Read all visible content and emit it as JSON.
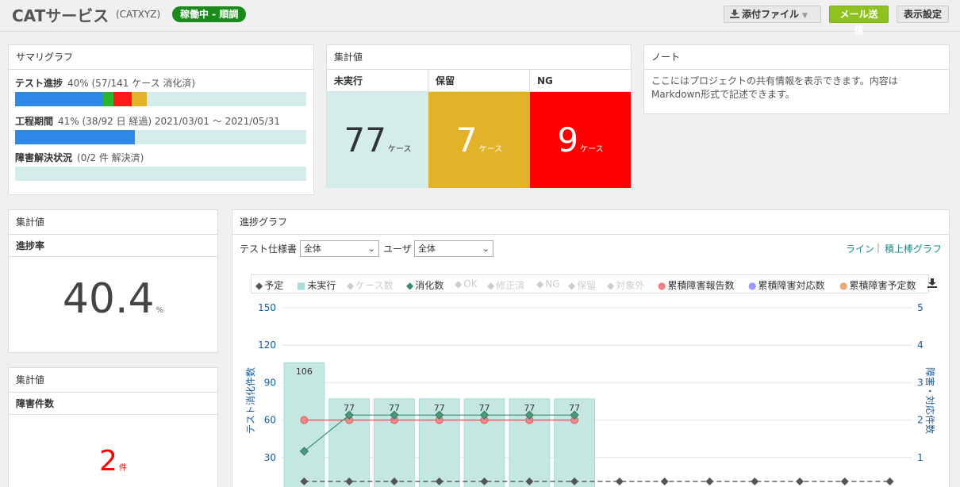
{
  "header": {
    "title": "CATサービス",
    "code": "(CATXYZ)",
    "status": "稼働中 - 順調",
    "attach_label": "添付ファイル",
    "mail_label": "メール送信",
    "display_label": "表示設定"
  },
  "summary": {
    "title": "サマリグラフ",
    "progress": {
      "label": "テスト進捗",
      "detail": "40% (57/141 ケース 消化済)",
      "value": 0.4
    },
    "schedule": {
      "label": "工程期間",
      "detail": "41% (38/92 日 経過)  2021/03/01 ～ 2021/05/31",
      "value": 0.41
    },
    "defects": {
      "label": "障害解決状況",
      "detail": "(0/2 件 解決済)",
      "value": 0
    }
  },
  "aggregate": {
    "title": "集計値",
    "cols": [
      {
        "head": "未実行",
        "value": "77",
        "unit": "ケース",
        "bg": "#d4ecea",
        "fg": "#333333"
      },
      {
        "head": "保留",
        "value": "7",
        "unit": "ケース",
        "bg": "#e2b229",
        "fg": "#ffffff"
      },
      {
        "head": "NG",
        "value": "9",
        "unit": "ケース",
        "bg": "#ff0000",
        "fg": "#ffffff"
      }
    ]
  },
  "note": {
    "title": "ノート",
    "text": "ここにはプロジェクトの共有情報を表示できます。内容はMarkdown形式で記述できます。"
  },
  "rate": {
    "title": "集計値",
    "sub": "進捗率",
    "value": "40.4",
    "unit": "%"
  },
  "defect_count": {
    "title": "集計値",
    "sub": "障害件数",
    "value": "2",
    "unit": "件",
    "color": "#ff0000"
  },
  "progress_graph": {
    "title": "進捗グラフ",
    "spec_label": "テスト仕様書",
    "spec_value": "全体",
    "user_label": "ユーザ",
    "user_value": "全体",
    "link_line": "ライン",
    "link_sep": "|",
    "link_stack": "積上棒グラフ"
  },
  "chart_data": {
    "type": "bar",
    "legend": [
      {
        "name": "予定",
        "marker": "◆",
        "color": "#555555",
        "enabled": true
      },
      {
        "name": "未実行",
        "marker": "■",
        "color": "#a8dcd6",
        "enabled": true
      },
      {
        "name": "ケース数",
        "marker": "◆",
        "color": "#cccccc",
        "enabled": false
      },
      {
        "name": "消化数",
        "marker": "◆",
        "color": "#3a8a6a",
        "enabled": true
      },
      {
        "name": "OK",
        "marker": "◆",
        "color": "#cccccc",
        "enabled": false
      },
      {
        "name": "修正済",
        "marker": "◆",
        "color": "#cccccc",
        "enabled": false
      },
      {
        "name": "NG",
        "marker": "◆",
        "color": "#cccccc",
        "enabled": false
      },
      {
        "name": "保留",
        "marker": "◆",
        "color": "#cccccc",
        "enabled": false
      },
      {
        "name": "対象外",
        "marker": "◆",
        "color": "#cccccc",
        "enabled": false
      },
      {
        "name": "累積障害報告数",
        "marker": "●",
        "color": "#f08080",
        "enabled": true
      },
      {
        "name": "累積障害対応数",
        "marker": "●",
        "color": "#9999ff",
        "enabled": true
      },
      {
        "name": "累積障害予定数",
        "marker": "●",
        "color": "#e8a878",
        "enabled": true
      }
    ],
    "y_label": "テスト消化件数",
    "y2_label": "障害・対応件数",
    "y_ticks": [
      30,
      60,
      90,
      120,
      150
    ],
    "y2_ticks": [
      1,
      2,
      3,
      4,
      5
    ],
    "ylim": [
      0,
      150
    ],
    "y2lim": [
      0,
      5
    ],
    "n_slots": 14,
    "bars": [
      106,
      77,
      77,
      77,
      77,
      77,
      77
    ],
    "bar_labels": [
      "106",
      "77",
      "77",
      "77",
      "77",
      "77",
      "77"
    ],
    "consumed": [
      35,
      64,
      64,
      64,
      64,
      64,
      64
    ],
    "defect_reports": [
      2,
      2,
      2,
      2,
      2,
      2,
      2
    ],
    "plan": [
      0,
      0,
      0,
      0,
      0,
      0,
      0,
      0,
      0,
      0,
      0,
      0,
      0,
      0
    ]
  },
  "colors": {
    "accent": "#1a8a8a",
    "tick": "#1a5a99"
  }
}
